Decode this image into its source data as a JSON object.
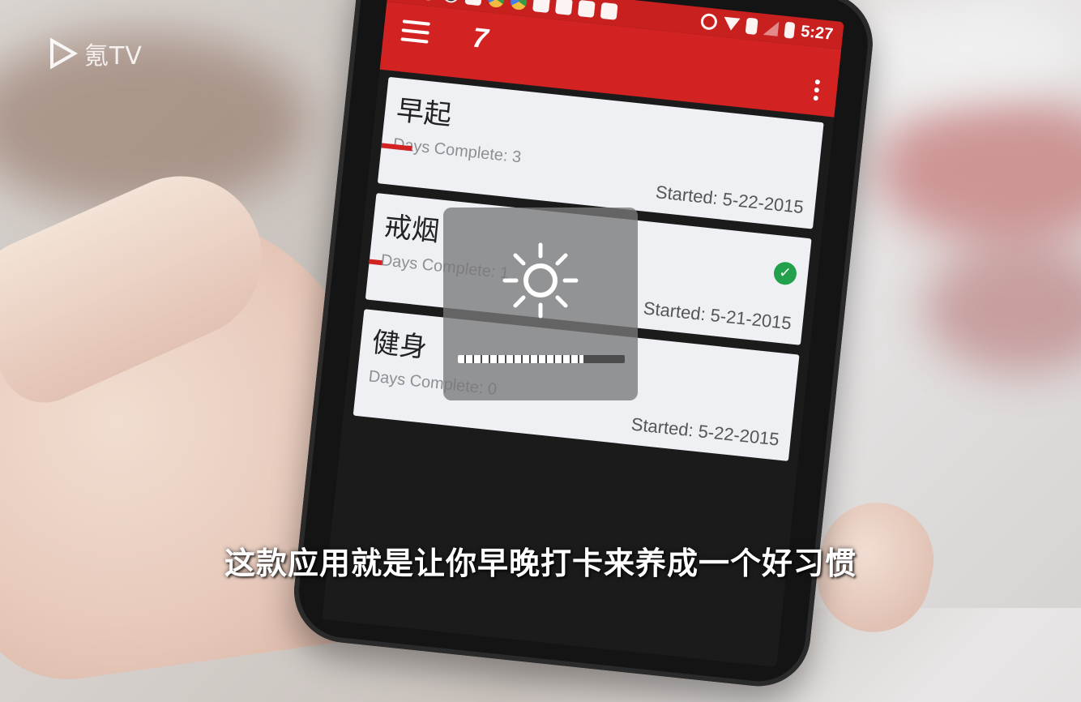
{
  "watermark": {
    "text": "氪TV"
  },
  "phone": {
    "status_bar": {
      "time": "5:27",
      "icons": [
        "chat-icon",
        "game-icon",
        "game-icon",
        "messenger-icon",
        "chrome-icon",
        "chrome-icon",
        "qr-icon",
        "lock-icon",
        "square-icon",
        "square-icon",
        "block-icon",
        "wifi-icon",
        "battery-saver-icon",
        "signal-icon",
        "battery-icon"
      ]
    },
    "toolbar": {
      "logo_text": "7",
      "menu_icon": "menu-icon",
      "overflow_icon": "more-vert-icon"
    },
    "cards": [
      {
        "title": "早起",
        "days_complete": "Days Complete: 3",
        "started": "Started: 5-22-2015",
        "progress": 0.07,
        "checked": false
      },
      {
        "title": "戒烟",
        "days_complete": "Days Complete: 1",
        "started": "Started: 5-21-2015",
        "progress": 0.03,
        "checked": true
      },
      {
        "title": "健身",
        "days_complete": "Days Complete: 0",
        "started": "Started: 5-22-2015",
        "progress": 0,
        "checked": false
      }
    ]
  },
  "brightness_hud": {
    "icon": "brightness-icon",
    "level": 0.75
  },
  "subtitle": "这款应用就是让你早晚打卡来养成一个好习惯",
  "colors": {
    "accent": "#d32222",
    "status_bar": "#c81f1f",
    "check": "#22a04b"
  }
}
